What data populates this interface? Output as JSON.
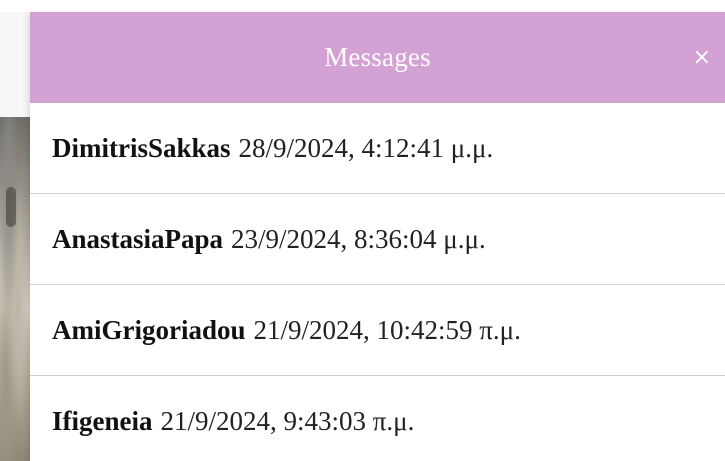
{
  "panel": {
    "title": "Messages",
    "close_label": "×",
    "header_color": "#d3a1d3"
  },
  "messages": [
    {
      "sender": "DimitrisSakkas",
      "timestamp": "28/9/2024, 4:12:41 μ.μ."
    },
    {
      "sender": "AnastasiaPapa",
      "timestamp": "23/9/2024, 8:36:04 μ.μ."
    },
    {
      "sender": "AmiGrigoriadou",
      "timestamp": "21/9/2024, 10:42:59 π.μ."
    },
    {
      "sender": "Ifigeneia",
      "timestamp": "21/9/2024, 9:43:03 π.μ."
    }
  ]
}
